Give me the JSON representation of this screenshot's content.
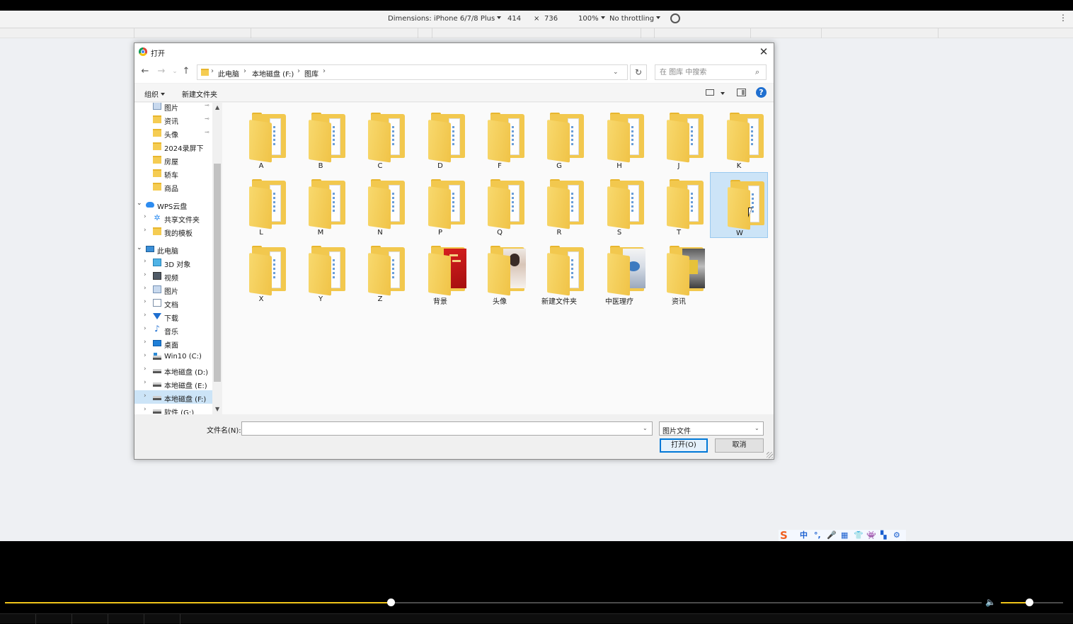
{
  "devtools": {
    "dimensions_label": "Dimensions: iPhone 6/7/8 Plus",
    "width": "414",
    "times": "×",
    "height": "736",
    "zoom": "100%",
    "throttling": "No throttling"
  },
  "dialog": {
    "title": "打开",
    "close_glyph": "✕"
  },
  "nav": {
    "back_glyph": "←",
    "forward_glyph": "→",
    "recent_glyph": "⌄",
    "up_glyph": "↑",
    "breadcrumbs": [
      "此电脑",
      "本地磁盘 (F:)",
      "图库"
    ],
    "crumb_sep": "›",
    "dropdown_glyph": "⌄",
    "refresh_glyph": "↻",
    "search_placeholder": "在 图库 中搜索",
    "search_glyph": "⌕"
  },
  "toolbar": {
    "organize_label": "组织",
    "new_folder_label": "新建文件夹",
    "help_glyph": "?"
  },
  "navpane": {
    "expand_glyph": "›",
    "open_glyph": "⌄",
    "pin_glyph": "📌",
    "scroll_up_glyph": "▲",
    "scroll_down_glyph": "▼",
    "items": [
      {
        "label": "图片",
        "pinned": true,
        "icon": "pictures-icon"
      },
      {
        "label": "资讯",
        "pinned": true,
        "icon": "folder-icon"
      },
      {
        "label": "头像",
        "pinned": true,
        "icon": "folder-icon"
      },
      {
        "label": "2024录屏下",
        "pinned": false,
        "icon": "folder-icon"
      },
      {
        "label": "房屋",
        "pinned": false,
        "icon": "folder-icon"
      },
      {
        "label": "轿车",
        "pinned": false,
        "icon": "folder-icon"
      },
      {
        "label": "商品",
        "pinned": false,
        "icon": "folder-icon"
      },
      {
        "label": "WPS云盘",
        "icon": "cloud-icon"
      },
      {
        "label": "共享文件夹",
        "icon": "share-icon"
      },
      {
        "label": "我的模板",
        "icon": "folder-icon"
      },
      {
        "label": "此电脑",
        "icon": "computer-icon"
      },
      {
        "label": "3D 对象",
        "icon": "3d-objects-icon"
      },
      {
        "label": "视频",
        "icon": "video-icon"
      },
      {
        "label": "图片",
        "icon": "pictures-icon"
      },
      {
        "label": "文档",
        "icon": "documents-icon"
      },
      {
        "label": "下载",
        "icon": "download-icon"
      },
      {
        "label": "音乐",
        "icon": "music-icon"
      },
      {
        "label": "桌面",
        "icon": "desktop-icon"
      },
      {
        "label": "Win10 (C:)",
        "icon": "system-drive-icon"
      },
      {
        "label": "本地磁盘 (D:)",
        "icon": "drive-icon"
      },
      {
        "label": "本地磁盘 (E:)",
        "icon": "drive-icon"
      },
      {
        "label": "本地磁盘 (F:)",
        "icon": "drive-icon",
        "selected": true
      },
      {
        "label": "软件 (G:)",
        "icon": "drive-icon"
      }
    ],
    "music_glyph": "♪",
    "share_glyph": "✲"
  },
  "files": {
    "items": [
      {
        "name": "A",
        "kind": "folder"
      },
      {
        "name": "B",
        "kind": "folder"
      },
      {
        "name": "C",
        "kind": "folder"
      },
      {
        "name": "D",
        "kind": "folder"
      },
      {
        "name": "F",
        "kind": "folder"
      },
      {
        "name": "G",
        "kind": "folder"
      },
      {
        "name": "H",
        "kind": "folder"
      },
      {
        "name": "J",
        "kind": "folder"
      },
      {
        "name": "K",
        "kind": "folder"
      },
      {
        "name": "L",
        "kind": "folder"
      },
      {
        "name": "M",
        "kind": "folder"
      },
      {
        "name": "N",
        "kind": "folder"
      },
      {
        "name": "P",
        "kind": "folder"
      },
      {
        "name": "Q",
        "kind": "folder"
      },
      {
        "name": "R",
        "kind": "folder"
      },
      {
        "name": "S",
        "kind": "folder"
      },
      {
        "name": "T",
        "kind": "folder"
      },
      {
        "name": "W",
        "kind": "folder",
        "selected": true
      },
      {
        "name": "X",
        "kind": "folder"
      },
      {
        "name": "Y",
        "kind": "folder"
      },
      {
        "name": "Z",
        "kind": "folder"
      },
      {
        "name": "背景",
        "kind": "thumb-red"
      },
      {
        "name": "头像",
        "kind": "thumb-photo"
      },
      {
        "name": "新建文件夹",
        "kind": "folder"
      },
      {
        "name": "中医理疗",
        "kind": "thumb-med"
      },
      {
        "name": "资讯",
        "kind": "thumb-info"
      }
    ]
  },
  "bottom": {
    "filename_label": "文件名(N):",
    "filename_value": "",
    "filename_drop_glyph": "⌄",
    "filetype_value": "图片文件",
    "filetype_drop_glyph": "⌄",
    "open_label": "打开(O)",
    "cancel_label": "取消"
  },
  "player": {
    "progress": 0.395,
    "volume": 0.45,
    "volume_glyph": "🔈"
  },
  "ime": {
    "logo": "S",
    "items": [
      "中",
      "°,",
      "🎤",
      "▦",
      "👕",
      "👾",
      "▚",
      "⚙"
    ]
  },
  "colors": {
    "accent_yellow": "#f0c419",
    "selection_blue": "#cce4f7",
    "button_border": "#0078d7"
  }
}
